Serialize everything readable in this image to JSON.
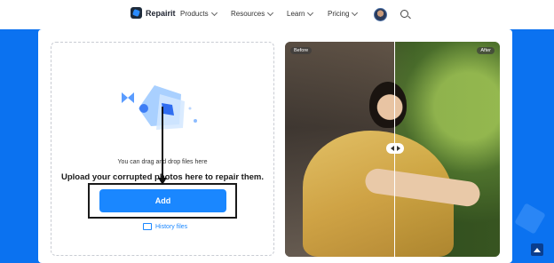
{
  "nav": {
    "brand": "Repairit",
    "items": [
      {
        "label": "Products"
      },
      {
        "label": "Resources"
      },
      {
        "label": "Learn"
      },
      {
        "label": "Pricing"
      }
    ]
  },
  "upload": {
    "drag_hint": "You can drag and drop files here",
    "headline": "Upload your corrupted photos here to repair them.",
    "add_label": "Add",
    "history_label": "History files"
  },
  "preview": {
    "before_label": "Before",
    "after_label": "After"
  },
  "colors": {
    "accent": "#1a87ff",
    "hero": "#0b72f0"
  }
}
